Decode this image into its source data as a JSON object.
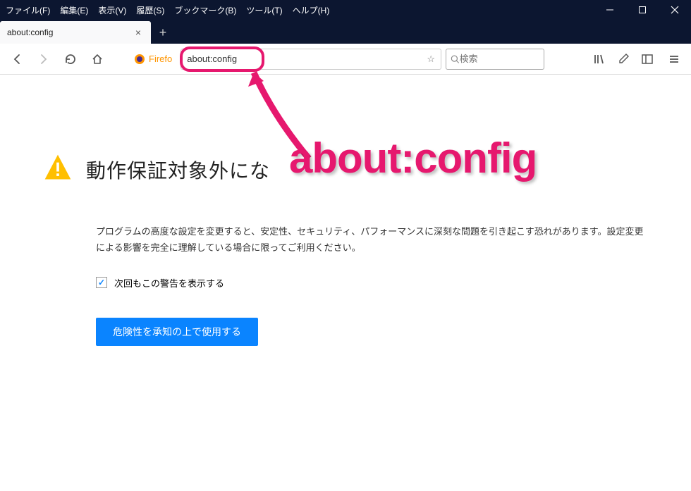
{
  "menubar": {
    "file": "ファイル(F)",
    "edit": "編集(E)",
    "view": "表示(V)",
    "history": "履歴(S)",
    "bookmarks": "ブックマーク(B)",
    "tools": "ツール(T)",
    "help": "ヘルプ(H)"
  },
  "tab": {
    "label": "about:config"
  },
  "identity": {
    "label": "Firefo"
  },
  "urlbar": {
    "value": "about:config"
  },
  "searchbar": {
    "placeholder": "検索"
  },
  "warning": {
    "heading": "動作保証対象外にな",
    "body": "プログラムの高度な設定を変更すると、安定性、セキュリティ、パフォーマンスに深刻な問題を引き起こす恐れがあります。設定変更による影響を完全に理解している場合に限ってご利用ください。",
    "checkbox_label": "次回もこの警告を表示する",
    "button": "危険性を承知の上で使用する"
  },
  "annotation": {
    "text": "about:config"
  }
}
